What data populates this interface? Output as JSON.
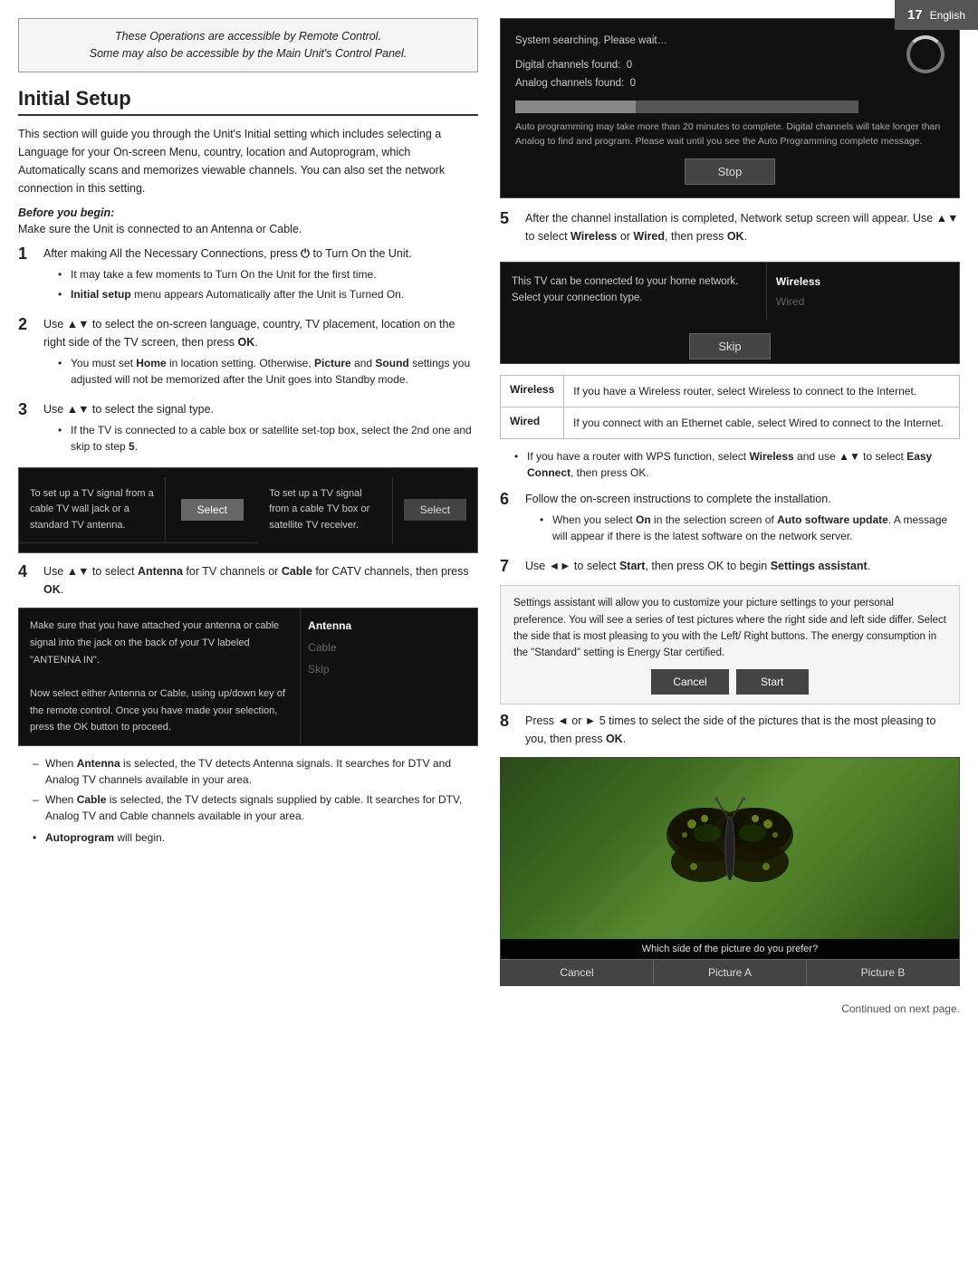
{
  "topbar": {
    "page_number": "17",
    "language": "English"
  },
  "notice": {
    "line1": "These Operations are accessible by Remote Control.",
    "line2": "Some may also be accessible by the Main Unit's Control Panel."
  },
  "section": {
    "title": "Initial Setup"
  },
  "intro": "This section will guide you through the Unit's Initial setting which includes selecting a Language for your On-screen Menu, country, location and Autoprogram, which Automatically scans and memorizes viewable channels. You can also set the network connection in this setting.",
  "before_begin": {
    "label": "Before you begin:",
    "text": "Make sure the Unit is connected to an Antenna or Cable."
  },
  "steps": {
    "step1": {
      "number": "1",
      "text": "After making All the Necessary Connections, press",
      "power_symbol": "⏻",
      "text2": "to Turn On the Unit.",
      "bullets": [
        "It may take a few moments to Turn On the Unit for the first time.",
        "Initial setup menu appears Automatically after the Unit is Turned On."
      ]
    },
    "step2": {
      "number": "2",
      "text": "Use ▲▼ to select the on-screen language, country, TV placement, location on the right side of the TV screen, then press OK.",
      "bullets": [
        "You must set Home in location setting. Otherwise, Picture and Sound settings you adjusted will not be memorized after the Unit goes into Standby mode."
      ]
    },
    "step3": {
      "number": "3",
      "text": "Use ▲▼ to select the signal type.",
      "bullets": [
        "If the TV is connected to a cable box or satellite set-top box, select the 2nd one and skip to step 5."
      ]
    },
    "signal_box": {
      "row1": {
        "left": "To set up a TV signal from a cable TV wall jack or a standard TV antenna.",
        "right": "Select"
      },
      "row2": {
        "left": "To set up a TV signal from a cable TV box or satellite TV receiver.",
        "right": "Select"
      }
    },
    "step4": {
      "number": "4",
      "text": "Use ▲▼ to select Antenna for TV channels or Cable for CATV channels, then press OK."
    },
    "antenna_box": {
      "left1": "Make sure that you have attached your antenna or cable signal into the jack on the back of your TV labeled \"ANTENNA IN\".",
      "left2": "Now select either Antenna or Cable, using up/down key of the remote control. Once you have made your selection, press the OK button to proceed.",
      "options": [
        "Antenna",
        "Cable",
        "Skip"
      ]
    },
    "dash_items": [
      "When Antenna is selected, the TV detects Antenna signals. It searches for DTV and Analog TV channels available in your area.",
      "When Cable is selected, the TV detects signals supplied by cable. It searches for DTV, Analog TV and Cable channels available in your area."
    ],
    "autoprogram": "Autoprogram will begin.",
    "step5": {
      "number": "5",
      "text": "After the channel installation is completed, Network setup screen will appear. Use ▲▼ to select Wireless or Wired, then press OK."
    },
    "scanning_box": {
      "title": "System searching. Please wait…",
      "digital": "Digital channels found:",
      "digital_val": "0",
      "analog": "Analog channels found:",
      "analog_val": "0",
      "note": "Auto programming may take more than 20 minutes to complete. Digital channels will take longer than Analog to find and program. Please wait until you see the Auto Programming complete message.",
      "stop_btn": "Stop"
    },
    "network_box": {
      "left": "This TV can be connected to your home network. Select your connection type.",
      "wireless": "Wireless",
      "wired": "Wired",
      "skip": "Skip"
    },
    "connection_table": {
      "rows": [
        {
          "type": "Wireless",
          "desc": "If you have a Wireless router, select Wireless to connect to the Internet."
        },
        {
          "type": "Wired",
          "desc": "If you connect with an Ethernet cable, select Wired to connect to the Internet."
        }
      ]
    },
    "step5_notes": [
      "If you have a router with WPS function, select Wireless and use ▲▼ to select Easy Connect, then press OK."
    ],
    "step6": {
      "number": "6",
      "text": "Follow the on-screen instructions to complete the installation.",
      "bullets": [
        "When you select On in the selection screen of Auto software update. A message will appear if there is the latest software on the network server."
      ]
    },
    "step7": {
      "number": "7",
      "text": "Use ◄► to select Start, then press OK to begin Settings assistant."
    },
    "settings_box": {
      "text": "Settings assistant will allow you to customize your picture settings to your personal preference. You will see a series of test pictures where the right side and left side differ. Select the side that is most pleasing to you with the Left/ Right buttons. The energy consumption in the \"Standard\" setting is Energy Star certified.",
      "cancel": "Cancel",
      "start": "Start"
    },
    "step8": {
      "number": "8",
      "text": "Press ◄ or ► 5 times to select the side of the pictures that is the most pleasing to you, then press OK."
    },
    "butterfly_box": {
      "caption": "Which side of the picture do you prefer?",
      "buttons": [
        "Cancel",
        "Picture A",
        "Picture B"
      ]
    }
  },
  "footer": {
    "text": "Continued on next page."
  }
}
